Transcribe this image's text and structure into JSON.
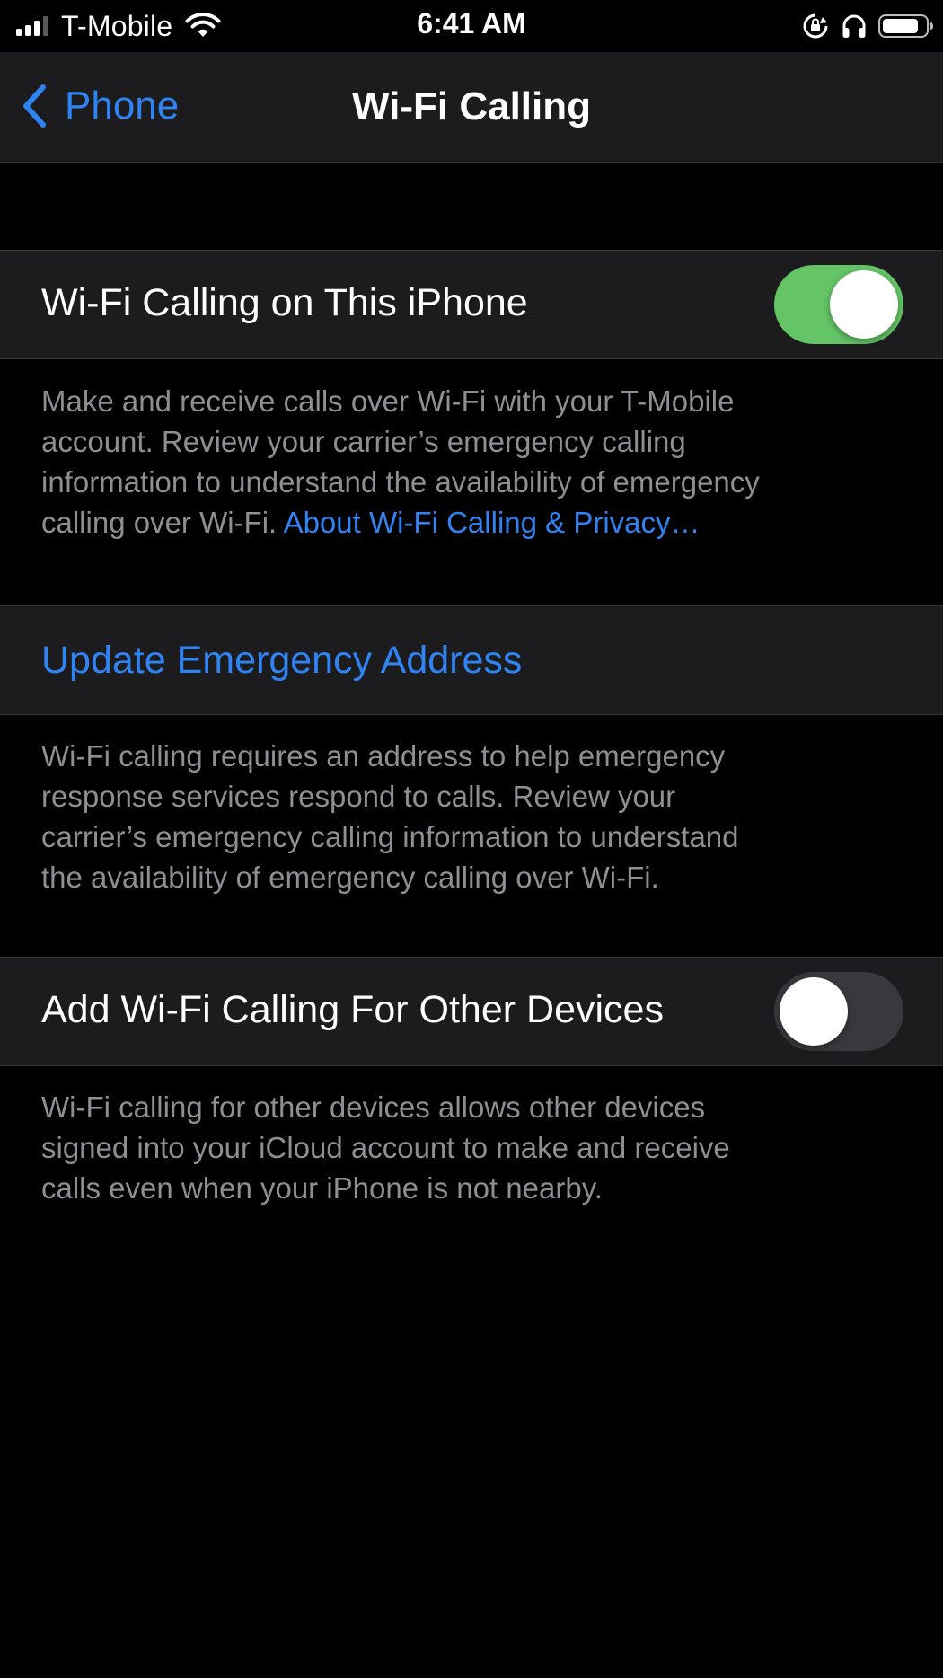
{
  "status_bar": {
    "carrier": "T-Mobile",
    "time": "6:41 AM",
    "signal_bars_filled": 3,
    "signal_bars_total": 4,
    "battery_level": 0.85,
    "icons": [
      "signal-icon",
      "wifi-icon",
      "orientation-lock-icon",
      "headphones-icon",
      "battery-icon"
    ]
  },
  "nav": {
    "back_label": "Phone",
    "title": "Wi-Fi Calling",
    "accent_color": "#2f83f3"
  },
  "wifi_calling": {
    "label": "Wi-Fi Calling on This iPhone",
    "enabled": true,
    "footer_lines": [
      "Make and receive calls over Wi-Fi with your T-Mobile",
      "account. Review your carrier’s emergency calling",
      "information to understand the availability of emergency",
      "calling over Wi-Fi. "
    ],
    "footer_link": "About Wi-Fi Calling & Privacy…"
  },
  "emergency_address": {
    "label": "Update Emergency Address",
    "footer_lines": [
      "Wi-Fi calling requires an address to help emergency",
      "response services respond to calls. Review your",
      "carrier’s emergency calling information to understand",
      "the availability of emergency calling over Wi-Fi."
    ]
  },
  "other_devices": {
    "label": "Add Wi-Fi Calling For Other Devices",
    "enabled": false,
    "footer_lines": [
      "Wi-Fi calling for other devices allows other devices",
      "signed into your iCloud account to make and receive",
      "calls even when your iPhone is not nearby."
    ]
  },
  "colors": {
    "switch_on": "#65c466",
    "switch_off": "#39393d",
    "cell_background": "#1c1c1e",
    "footer_text": "#8e8e93"
  }
}
